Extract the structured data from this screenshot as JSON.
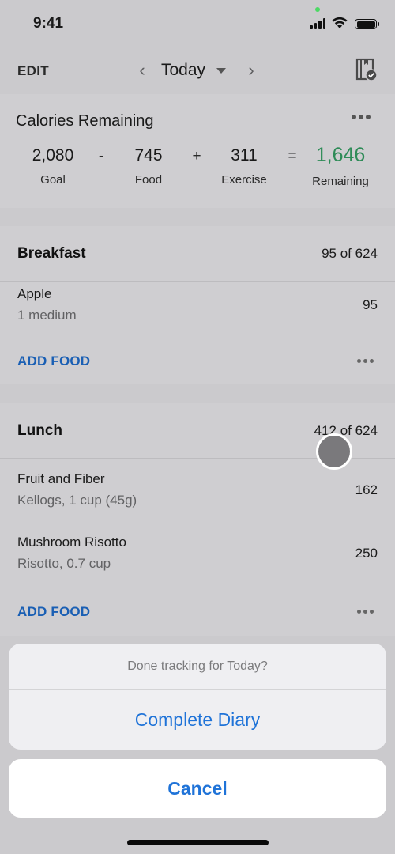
{
  "status_bar": {
    "time": "9:41",
    "icons": [
      "microphone-active-dot",
      "signal-icon",
      "wifi-icon",
      "battery-icon"
    ]
  },
  "nav": {
    "edit_label": "EDIT",
    "prev_icon": "chevron-left-icon",
    "date_label": "Today",
    "dropdown_icon": "caret-down-icon",
    "next_icon": "chevron-right-icon",
    "diary_icon": "diary-complete-icon"
  },
  "calories": {
    "title": "Calories Remaining",
    "goal": {
      "value": "2,080",
      "label": "Goal"
    },
    "minus": "-",
    "food": {
      "value": "745",
      "label": "Food"
    },
    "plus": "+",
    "exercise": {
      "value": "311",
      "label": "Exercise"
    },
    "equals": "=",
    "remaining": {
      "value": "1,646",
      "label": "Remaining"
    },
    "accent_color": "#2e8b57"
  },
  "meals": {
    "breakfast": {
      "name": "Breakfast",
      "total": "95 of 624",
      "items": [
        {
          "name": "Apple",
          "desc": "1 medium",
          "calories": "95"
        }
      ],
      "add_label": "ADD FOOD"
    },
    "lunch": {
      "name": "Lunch",
      "total": "412 of 624",
      "items": [
        {
          "name": "Fruit and Fiber",
          "desc": "Kellogs, 1 cup (45g)",
          "calories": "162"
        },
        {
          "name": "Mushroom Risotto",
          "desc": "Risotto, 0.7 cup",
          "calories": "250"
        }
      ],
      "add_label": "ADD FOOD"
    }
  },
  "action_sheet": {
    "message": "Done tracking for Today?",
    "action_label": "Complete Diary",
    "cancel_label": "Cancel",
    "action_color": "#1f73d8"
  }
}
